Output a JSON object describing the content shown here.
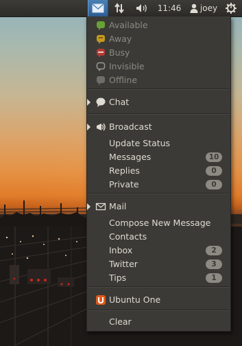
{
  "panel": {
    "clock": "11:46",
    "user": "joey",
    "icons": [
      "mail-icon",
      "network-icon",
      "volume-icon",
      "user-icon",
      "power-gear-icon"
    ]
  },
  "status_items": [
    {
      "label": "Available",
      "icon": "status-available-icon",
      "color": "#6aa137"
    },
    {
      "label": "Away",
      "icon": "status-away-icon",
      "color": "#c49a1e"
    },
    {
      "label": "Busy",
      "icon": "status-busy-icon",
      "color": "#b23a33"
    },
    {
      "label": "Invisible",
      "icon": "status-invisible-icon",
      "color": "#9a9892"
    },
    {
      "label": "Offline",
      "icon": "status-offline-icon",
      "color": "#6e6d69"
    }
  ],
  "chat": {
    "label": "Chat"
  },
  "broadcast": {
    "label": "Broadcast",
    "items": [
      {
        "label": "Update Status"
      },
      {
        "label": "Messages",
        "count": "10"
      },
      {
        "label": "Replies",
        "count": "0"
      },
      {
        "label": "Private",
        "count": "0"
      }
    ]
  },
  "mail": {
    "label": "Mail",
    "items": [
      {
        "label": "Compose New Message"
      },
      {
        "label": "Contacts"
      },
      {
        "label": "Inbox",
        "count": "2"
      },
      {
        "label": "Twitter",
        "count": "3"
      },
      {
        "label": "Tips",
        "count": "1"
      }
    ]
  },
  "ubuntu_one": {
    "label": "Ubuntu One",
    "icon_color": "#e05a1d"
  },
  "clear": {
    "label": "Clear"
  },
  "colors": {
    "panel_active": "#3b6fa6",
    "menu_bg": "#3b3a36",
    "badge_bg": "#8c8a83"
  }
}
